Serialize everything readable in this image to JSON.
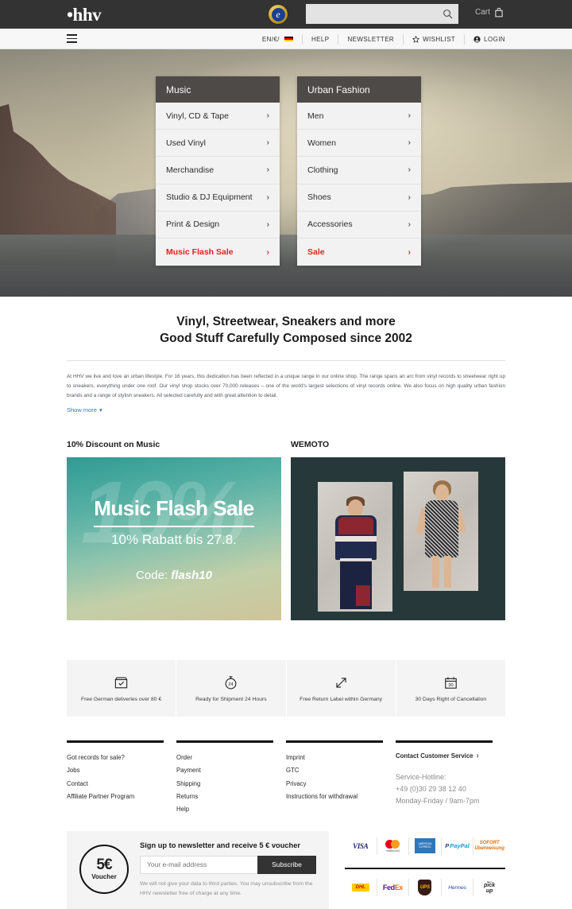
{
  "header": {
    "logo": "•hhv",
    "search_placeholder": "",
    "search_value": "",
    "cart_label": "Cart",
    "trust_badge": "e"
  },
  "subnav": {
    "locale": "EN/€/",
    "items": [
      {
        "label": "HELP",
        "icon": ""
      },
      {
        "label": "NEWSLETTER",
        "icon": ""
      },
      {
        "label": "WISHLIST",
        "icon": "star-icon"
      },
      {
        "label": "LOGIN",
        "icon": "user-icon"
      }
    ]
  },
  "menus": [
    {
      "title": "Music",
      "items": [
        {
          "label": "Vinyl, CD & Tape",
          "sale": false
        },
        {
          "label": "Used Vinyl",
          "sale": false
        },
        {
          "label": "Merchandise",
          "sale": false
        },
        {
          "label": "Studio & DJ Equipment",
          "sale": false
        },
        {
          "label": "Print & Design",
          "sale": false
        },
        {
          "label": "Music Flash Sale",
          "sale": true
        }
      ]
    },
    {
      "title": "Urban Fashion",
      "items": [
        {
          "label": "Men",
          "sale": false
        },
        {
          "label": "Women",
          "sale": false
        },
        {
          "label": "Clothing",
          "sale": false
        },
        {
          "label": "Shoes",
          "sale": false
        },
        {
          "label": "Accessories",
          "sale": false
        },
        {
          "label": "Sale",
          "sale": true
        }
      ]
    }
  ],
  "intro": {
    "headline_line1": "Vinyl, Streetwear, Sneakers and more",
    "headline_line2": "Good Stuff Carefully Composed since 2002",
    "body": "At HHV we live and love an urban lifestyle. For 16 years, this dedication has been reflected in a unique range in our online shop. The range spans an arc from vinyl records to streetwear right up to sneakers, everything under one roof. Our vinyl shop stocks over 70,000 releases – one of the world's largest selections of vinyl records online. We also focus on high quality urban fashion brands and a range of stylish sneakers. All selected carefully and with great attention to detail.",
    "show_more": "Show more"
  },
  "promos": [
    {
      "title": "10% Discount on Music",
      "ghost": "10%",
      "line1": "Music Flash Sale",
      "line2": "10% Rabatt bis 27.8.",
      "code_label": "Code:",
      "code": "flash10"
    },
    {
      "title": "WEMOTO"
    }
  ],
  "benefits": [
    {
      "icon": "package-check-icon",
      "label": "Free German deliveries over 80 €"
    },
    {
      "icon": "stopwatch-24-icon",
      "label": "Ready for Shipment 24 Hours"
    },
    {
      "icon": "return-arrow-icon",
      "label": "Free Return Label within Germany"
    },
    {
      "icon": "calendar-30-icon",
      "label": "30 Days Right of Cancellation"
    }
  ],
  "footer_columns": [
    {
      "links": [
        "Got records for sale?",
        "Jobs",
        "Contact",
        "Affiliate Partner Program"
      ]
    },
    {
      "links": [
        "Order",
        "Payment",
        "Shipping",
        "Returns",
        "Help"
      ]
    },
    {
      "links": [
        "Imprint",
        "GTC",
        "Privacy",
        "Instructions for withdrawal"
      ]
    }
  ],
  "customer_service": {
    "link": "Contact Customer Service",
    "hotline_label": "Service-Hotline:",
    "phone": "+49 (0)30 29 38 12 40",
    "hours": "Monday-Friday / 9am-7pm"
  },
  "newsletter": {
    "voucher_amount": "5€",
    "voucher_word": "Voucher",
    "title": "Sign up to newsletter and receive 5 € voucher",
    "placeholder": "Your e-mail address",
    "value": "",
    "button": "Subscribe",
    "note": "We will not give your data to third parties. You may unsubscribe from the HHV newsletter free of charge at any time."
  },
  "payment_methods": [
    {
      "name": "VISA",
      "kind": "visa"
    },
    {
      "name": "mastercard",
      "kind": "mastercard"
    },
    {
      "name": "AMERICAN EXPRESS",
      "kind": "amex"
    },
    {
      "name": "PayPal",
      "kind": "paypal"
    },
    {
      "name": "SOFORT Überweisung",
      "kind": "sofort"
    }
  ],
  "shipping_partners": [
    {
      "name": "DHL",
      "kind": "dhl"
    },
    {
      "name": "FedEx Express",
      "kind": "fedex"
    },
    {
      "name": "UPS",
      "kind": "ups"
    },
    {
      "name": "Hermes",
      "kind": "hermes"
    },
    {
      "name": "pick up",
      "kind": "pickup"
    }
  ],
  "colors": {
    "topbar": "#333333",
    "sale_red": "#e62020",
    "link_blue": "#3a76c6",
    "menu_head": "#4d4a48",
    "wemoto_bg": "#27383a"
  }
}
